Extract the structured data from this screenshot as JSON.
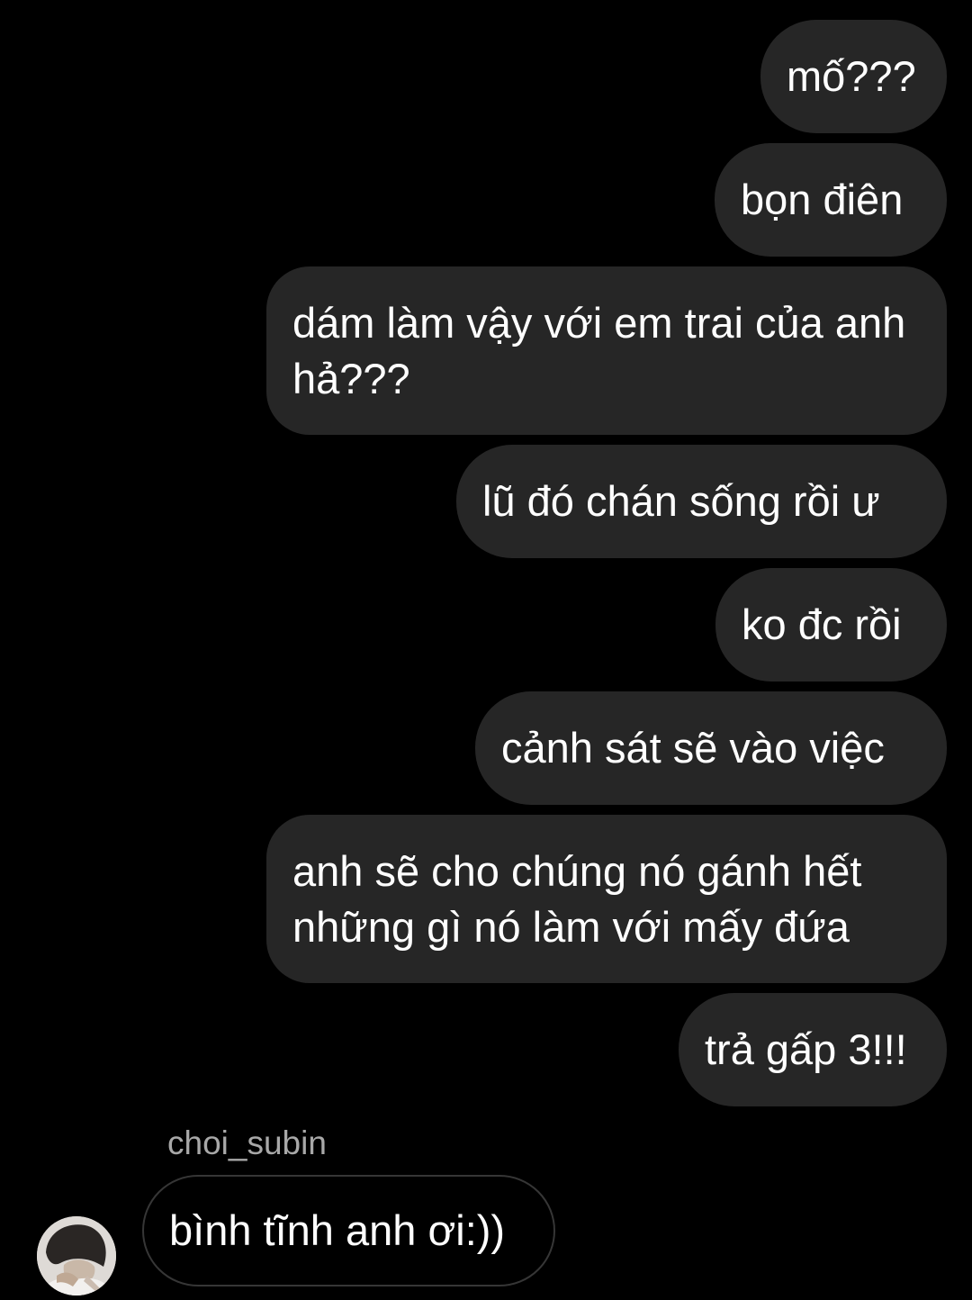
{
  "chat": {
    "outgoing": [
      {
        "text": "mố???"
      },
      {
        "text": "bọn điên"
      },
      {
        "text": "dám làm vậy với em trai của anh hả???"
      },
      {
        "text": "lũ đó chán sống rồi ư"
      },
      {
        "text": "ko đc rồi"
      },
      {
        "text": "cảnh sát sẽ vào việc"
      },
      {
        "text": "anh sẽ cho chúng nó gánh hết những gì nó làm với mấy đứa"
      },
      {
        "text": "trả gấp 3!!!"
      }
    ],
    "incoming": {
      "sender": "choi_subin",
      "text": "bình tĩnh anh ơi:))",
      "avatar_icon": "profile-avatar"
    }
  },
  "colors": {
    "background": "#000000",
    "outgoing_bubble": "#262626",
    "incoming_border": "#363636",
    "sender_name": "#a8a8a8",
    "text": "#ffffff"
  }
}
